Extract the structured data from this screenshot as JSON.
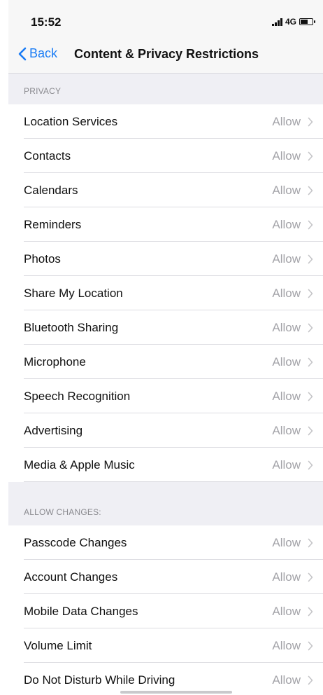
{
  "status_bar": {
    "time": "15:52",
    "network": "4G"
  },
  "nav": {
    "back_label": "Back",
    "title": "Content & Privacy Restrictions"
  },
  "sections": [
    {
      "header": "PRIVACY",
      "rows": [
        {
          "label": "Location Services",
          "value": "Allow"
        },
        {
          "label": "Contacts",
          "value": "Allow"
        },
        {
          "label": "Calendars",
          "value": "Allow"
        },
        {
          "label": "Reminders",
          "value": "Allow"
        },
        {
          "label": "Photos",
          "value": "Allow"
        },
        {
          "label": "Share My Location",
          "value": "Allow"
        },
        {
          "label": "Bluetooth Sharing",
          "value": "Allow"
        },
        {
          "label": "Microphone",
          "value": "Allow"
        },
        {
          "label": "Speech Recognition",
          "value": "Allow"
        },
        {
          "label": "Advertising",
          "value": "Allow"
        },
        {
          "label": "Media & Apple Music",
          "value": "Allow"
        }
      ]
    },
    {
      "header": "ALLOW CHANGES:",
      "rows": [
        {
          "label": "Passcode Changes",
          "value": "Allow"
        },
        {
          "label": "Account Changes",
          "value": "Allow"
        },
        {
          "label": "Mobile Data Changes",
          "value": "Allow"
        },
        {
          "label": "Volume Limit",
          "value": "Allow"
        },
        {
          "label": "Do Not Disturb While Driving",
          "value": "Allow"
        }
      ]
    }
  ],
  "colors": {
    "accent": "#1a7cf5",
    "secondary_text": "#a3a3a8",
    "group_background": "#efeff4"
  },
  "icons": [
    "back-chevron-icon",
    "signal-icon",
    "battery-icon",
    "disclosure-chevron-icon"
  ]
}
